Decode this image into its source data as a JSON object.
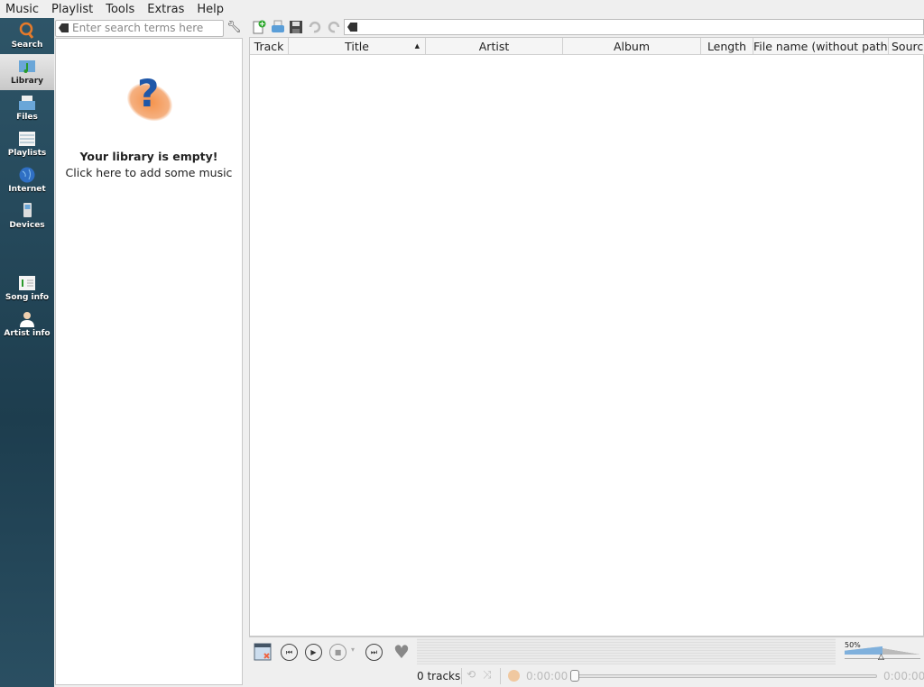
{
  "menu": [
    "Music",
    "Playlist",
    "Tools",
    "Extras",
    "Help"
  ],
  "sidebar": {
    "items": [
      {
        "label": "Search",
        "icon": "search-icon"
      },
      {
        "label": "Library",
        "icon": "library-icon",
        "active": true
      },
      {
        "label": "Files",
        "icon": "files-icon"
      },
      {
        "label": "Playlists",
        "icon": "playlists-icon"
      },
      {
        "label": "Internet",
        "icon": "globe-icon"
      },
      {
        "label": "Devices",
        "icon": "devices-icon"
      },
      {
        "label": "Song info",
        "icon": "song-info-icon"
      },
      {
        "label": "Artist info",
        "icon": "artist-info-icon"
      }
    ],
    "background": "#2e5568"
  },
  "library": {
    "search_placeholder": "Enter search terms here",
    "empty_title": "Your library is empty!",
    "empty_subtitle": "Click here to add some music"
  },
  "playlist": {
    "columns": [
      "Track",
      "Title",
      "Artist",
      "Album",
      "Length",
      "File name (without path)",
      "Source"
    ],
    "sorted_column": "Title",
    "sort_direction": "ascending"
  },
  "player": {
    "volume": "50%",
    "volume_level": 0.5
  },
  "status": {
    "tracks": "0 tracks",
    "elapsed": "0:00:00",
    "total": "0:00:00",
    "position": 0
  }
}
